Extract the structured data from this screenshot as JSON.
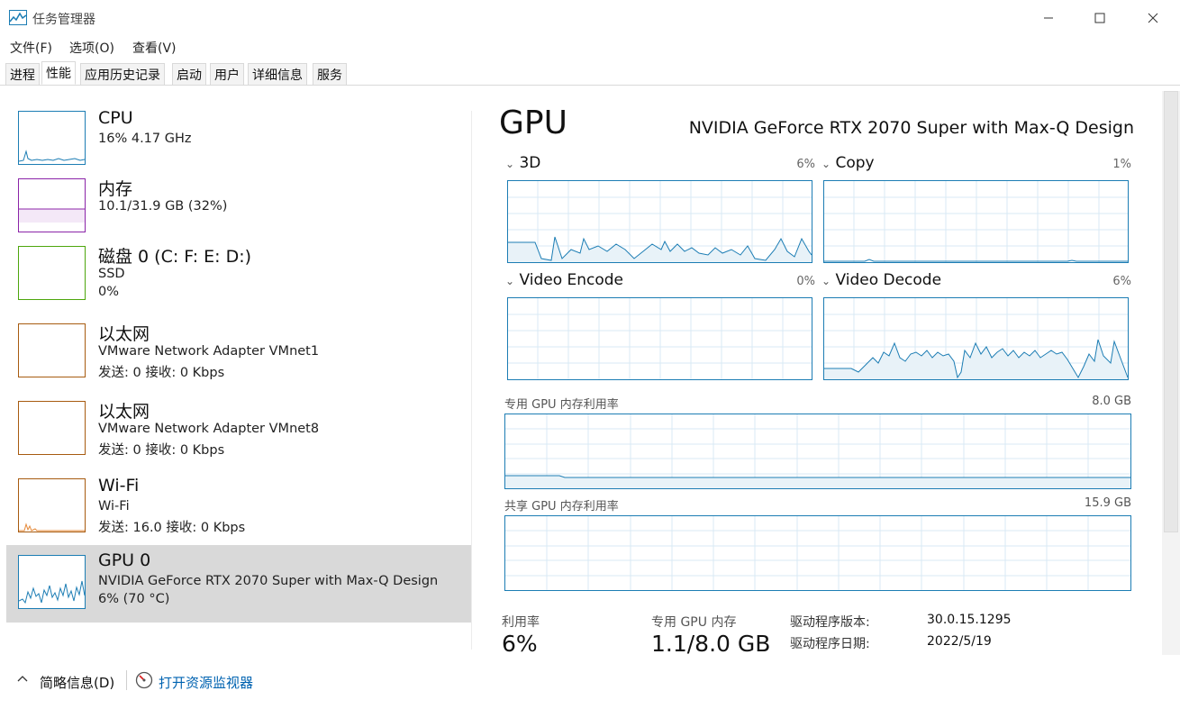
{
  "window": {
    "title": "任务管理器"
  },
  "menu": {
    "items": [
      "文件(F)",
      "选项(O)",
      "查看(V)"
    ]
  },
  "tabs": [
    "进程",
    "性能",
    "应用历史记录",
    "启动",
    "用户",
    "详细信息",
    "服务"
  ],
  "active_tab": "性能",
  "sidebar": {
    "items": [
      {
        "title": "CPU",
        "line2": "16% 4.17 GHz",
        "line3": "",
        "color": "#1c7db4",
        "selected": false
      },
      {
        "title": "内存",
        "line2": "10.1/31.9 GB (32%)",
        "line3": "",
        "color": "#8b24a8",
        "selected": false
      },
      {
        "title": "磁盘 0 (C: F: E: D:)",
        "line2": "SSD",
        "line3": "0%",
        "color": "#4da60c",
        "selected": false
      },
      {
        "title": "以太网",
        "line2": "VMware Network Adapter VMnet1",
        "line3": "发送: 0 接收: 0 Kbps",
        "color": "#a75b10",
        "selected": false
      },
      {
        "title": "以太网",
        "line2": "VMware Network Adapter VMnet8",
        "line3": "发送: 0 接收: 0 Kbps",
        "color": "#a75b10",
        "selected": false
      },
      {
        "title": "Wi-Fi",
        "line2": "Wi-Fi",
        "line3": "发送: 16.0 接收: 0 Kbps",
        "color": "#a75b10",
        "selected": false
      },
      {
        "title": "GPU 0",
        "line2": "NVIDIA GeForce RTX 2070 Super with Max-Q Design",
        "line3": "6% (70 °C)",
        "color": "#1c7db4",
        "selected": true
      }
    ]
  },
  "detail": {
    "heading": "GPU",
    "model": "NVIDIA GeForce RTX 2070 Super with Max-Q Design",
    "engines": [
      {
        "name": "3D",
        "percent": "6%"
      },
      {
        "name": "Copy",
        "percent": "1%"
      },
      {
        "name": "Video Encode",
        "percent": "0%"
      },
      {
        "name": "Video Decode",
        "percent": "6%"
      }
    ],
    "dedicated_memory": {
      "label": "专用 GPU 内存利用率",
      "capacity": "8.0 GB"
    },
    "shared_memory": {
      "label": "共享 GPU 内存利用率",
      "capacity": "15.9 GB"
    },
    "stats": {
      "utilization_label": "利用率",
      "utilization_value": "6%",
      "dedicated_label": "专用 GPU 内存",
      "dedicated_value": "1.1/8.0 GB"
    },
    "properties": [
      {
        "label": "驱动程序版本:",
        "value": "30.0.15.1295"
      },
      {
        "label": "驱动程序日期:",
        "value": "2022/5/19"
      }
    ]
  },
  "footer": {
    "summary_label": "简略信息(D)",
    "monitor_link": "打开资源监视器"
  },
  "colors": {
    "gpu_accent": "#1c7db4",
    "memory_accent": "#8b24a8",
    "disk_accent": "#4da60c",
    "network_accent": "#a75b10",
    "link": "#0063b1"
  }
}
